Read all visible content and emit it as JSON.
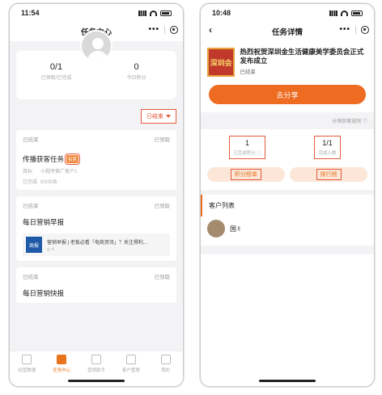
{
  "left": {
    "status_time": "11:54",
    "title": "任务中心",
    "nav_dots": "•••",
    "stats": [
      {
        "value": "0/1",
        "label": "已领取/已完成"
      },
      {
        "value": "0",
        "label": "今日积分"
      }
    ],
    "filter_label": "已结束",
    "cards": [
      {
        "status": "已结束",
        "action": "已领取",
        "title": "传播获客任务",
        "tag": "有奖",
        "rows": [
          {
            "k": "目标",
            "v": "小程序推广客户1"
          },
          {
            "k": "已完成",
            "v": "0/100条"
          }
        ]
      },
      {
        "status": "已结束",
        "action": "已领取",
        "title": "每日营销早报",
        "news_thumb": "周报",
        "news_text": "营销早报 | 老板必看「电商资讯」？关注得利...",
        "news_sub": "◎ 4"
      },
      {
        "status": "已结束",
        "action": "已领取",
        "title": "每日营销快报"
      }
    ],
    "tabs": [
      {
        "label": "经营数据",
        "active": false
      },
      {
        "label": "任务中心",
        "active": true
      },
      {
        "label": "营销助手",
        "active": false
      },
      {
        "label": "客户管理",
        "active": false
      },
      {
        "label": "我的",
        "active": false
      }
    ]
  },
  "right": {
    "status_time": "10:48",
    "title": "任务详情",
    "back": "‹",
    "nav_dots": "•••",
    "book_label": "深圳会",
    "headline": "热烈祝贺深圳金生活健康美学委员会正式发布成立",
    "status": "已结束",
    "share_label": "去分享",
    "rule_label": "分销获客规则 ⓘ",
    "stats": [
      {
        "value": "1",
        "label": "已完成积分 ⓘ"
      },
      {
        "value": "1/1",
        "label": "完成人数"
      }
    ],
    "btn_points": "积分榜单",
    "btn_rank": "排行榜",
    "list_title": "客户列表",
    "customer_name": "国✌"
  }
}
